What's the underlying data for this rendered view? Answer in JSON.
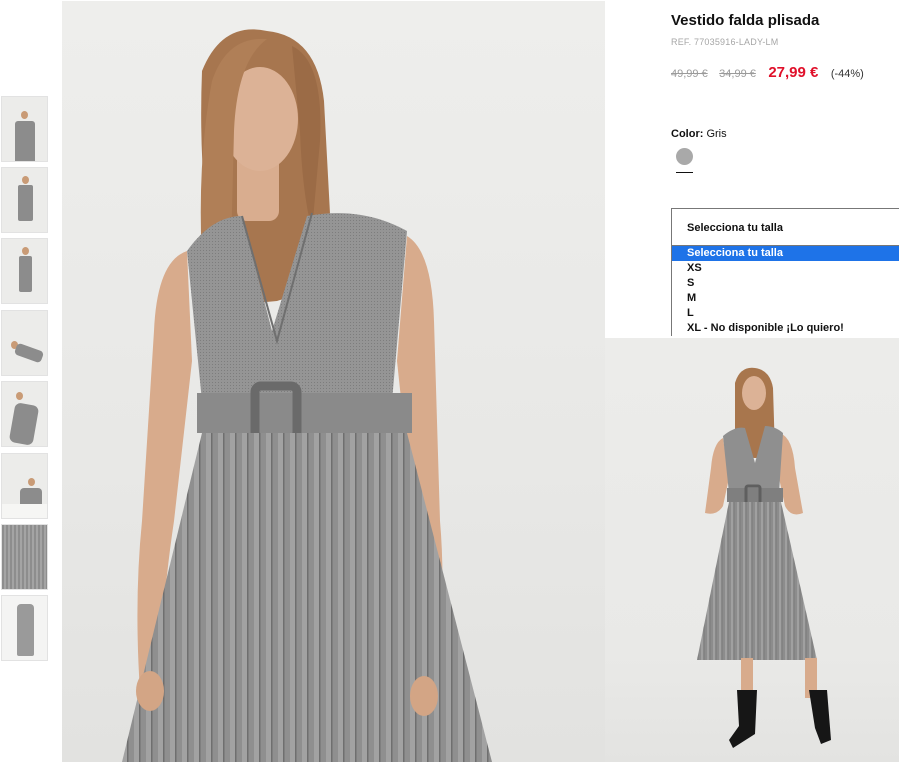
{
  "product": {
    "title": "Vestido falda plisada",
    "ref": "REF. 77035916-LADY-LM",
    "price_original": "49,99 €",
    "price_previous": "34,99 €",
    "price_sale": "27,99 €",
    "discount": "(-44%)",
    "sale_color": "#e0102a"
  },
  "color": {
    "label": "Color:",
    "value": "Gris",
    "swatch_hex": "#a9a9a9"
  },
  "size": {
    "placeholder": "Selecciona tu talla",
    "options": [
      "Selecciona tu talla",
      "XS",
      "S",
      "M",
      "L",
      "XL - No disponible ¡Lo quiero!"
    ],
    "selected_index": 0
  },
  "gallery": {
    "thumbnail_count": 8
  }
}
